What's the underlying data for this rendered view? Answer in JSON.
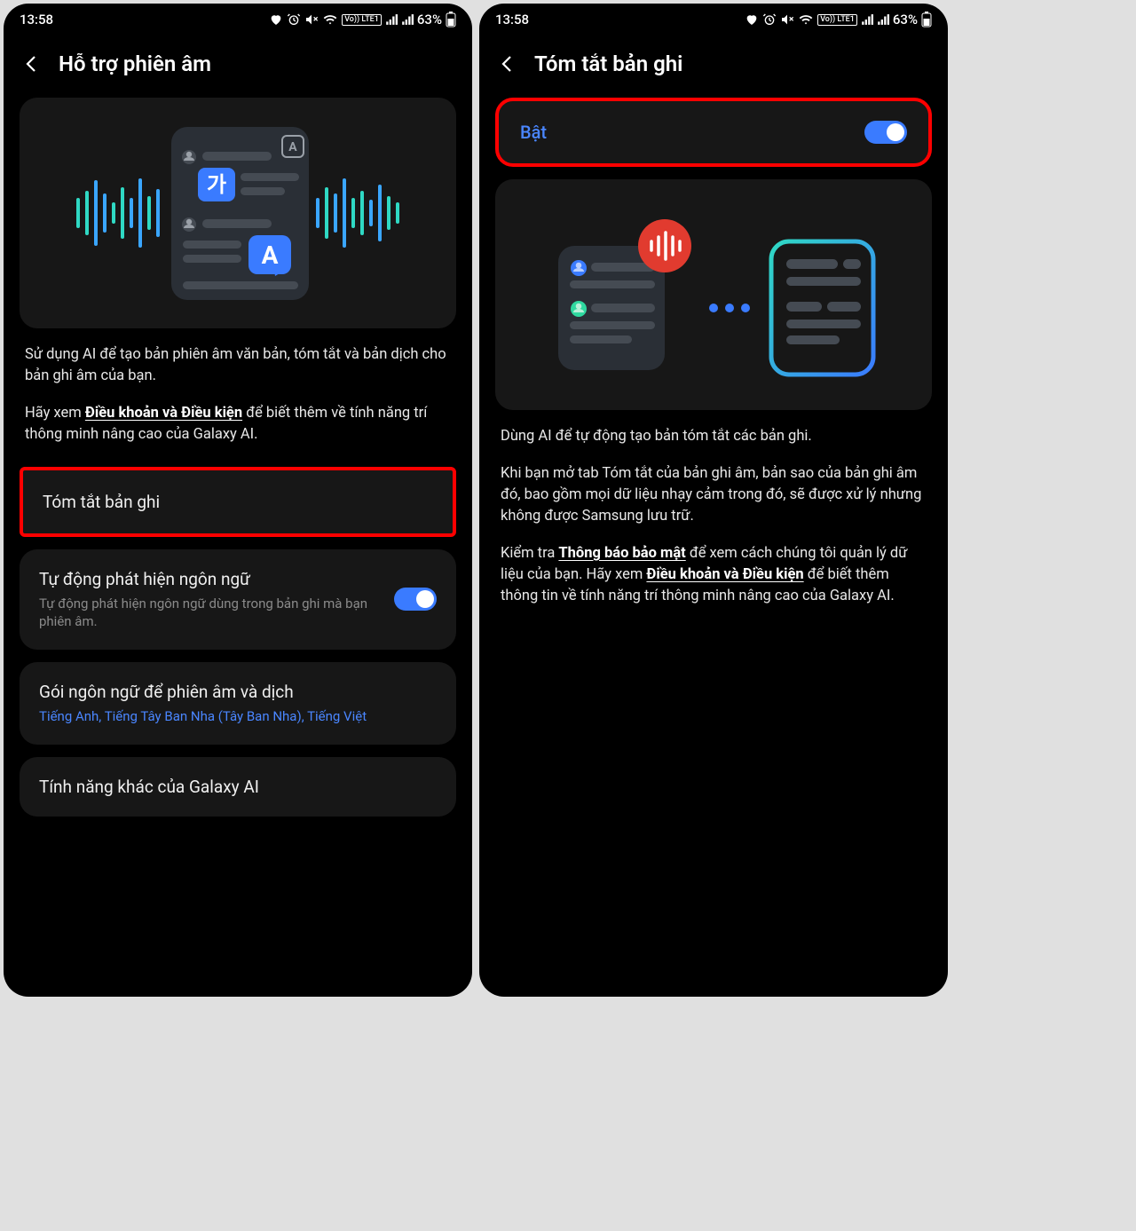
{
  "status": {
    "time": "13:58",
    "battery_text": "63%",
    "lte_label": "Vo)) LTE1"
  },
  "left": {
    "title": "Hỗ trợ phiên âm",
    "desc1": "Sử dụng AI để tạo bản phiên âm văn bản, tóm tắt và bản dịch cho bản ghi âm của bạn.",
    "desc2_prefix": "Hãy xem ",
    "desc2_link": "Điều khoản và Điều kiện",
    "desc2_suffix": " để biết thêm về tính năng trí thông minh nâng cao của Galaxy AI.",
    "item1": "Tóm tắt bản ghi",
    "item2_title": "Tự động phát hiện ngôn ngữ",
    "item2_sub": "Tự động phát hiện ngôn ngữ dùng trong bản ghi mà bạn phiên âm.",
    "item3_title": "Gói ngôn ngữ để phiên âm và dịch",
    "item3_sub": "Tiếng Anh, Tiếng Tây Ban Nha (Tây Ban Nha), Tiếng Việt",
    "item4": "Tính năng khác của Galaxy AI"
  },
  "right": {
    "title": "Tóm tắt bản ghi",
    "toggle_label": "Bật",
    "toggle_on": true,
    "desc1": "Dùng AI để tự động tạo bản tóm tắt các bản ghi.",
    "desc2": "Khi bạn mở tab Tóm tắt của bản ghi âm, bản sao của bản ghi âm đó, bao gồm mọi dữ liệu nhạy cảm trong đó, sẽ được xử lý nhưng không được Samsung lưu trữ.",
    "desc3_prefix": "Kiểm tra ",
    "desc3_link1": "Thông báo bảo mật",
    "desc3_mid": " để xem cách chúng tôi quản lý dữ liệu của bạn. Hãy xem ",
    "desc3_link2": "Điều khoản và Điều kiện",
    "desc3_suffix": " để biết thêm thông tin về tính năng trí thông minh nâng cao của Galaxy AI."
  }
}
